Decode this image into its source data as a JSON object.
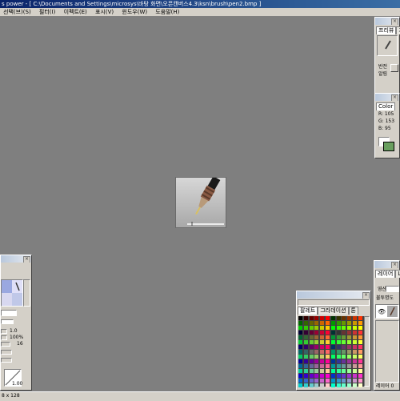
{
  "window": {
    "title": "s power - [ C:\\Documents and Settings\\microsys\\바탕 화면\\오픈캔버스4.3\\ksn\\brush\\pen2.bmp ]"
  },
  "menu": {
    "items": [
      "선택(브)(S)",
      "필터(I)",
      "이펙트(E)",
      "표시(V)",
      "윈도우(W)",
      "도움말(H)"
    ]
  },
  "brush_panel": {
    "tabs": [
      "프리뷰",
      "가"
    ],
    "side_label": "반전\n알림"
  },
  "color_panel": {
    "tab": "Color",
    "r_label": "R: 105",
    "g_label": "G: 153",
    "b_label": "B:  95",
    "fg_color": "#699f5f",
    "bg_color": "#ffffff"
  },
  "left_panel": {
    "value_1": "1.0",
    "value_2": "100%",
    "value_3": "16",
    "value_4": "1.00"
  },
  "palette_panel": {
    "tabs": [
      "팔레트",
      "그라데이션",
      "톤"
    ]
  },
  "layer_panel": {
    "tabs": [
      "레이어",
      "L"
    ],
    "mode_label": "영산",
    "opacity_label": "불투명도"
  },
  "status": {
    "size_text": "8 x 128",
    "layer_text": "레이어 0"
  },
  "palette_colors": [
    "#000000",
    "#330000",
    "#660000",
    "#990000",
    "#cc0000",
    "#ff0000",
    "#003300",
    "#333300",
    "#663300",
    "#993300",
    "#cc3300",
    "#ff3300",
    "#006600",
    "#336600",
    "#666600",
    "#996600",
    "#cc6600",
    "#ff6600",
    "#009900",
    "#339900",
    "#669900",
    "#999900",
    "#cc9900",
    "#ff9900",
    "#00cc00",
    "#33cc00",
    "#66cc00",
    "#99cc00",
    "#cccc00",
    "#ffcc00",
    "#00ff00",
    "#33ff00",
    "#66ff00",
    "#99ff00",
    "#ccff00",
    "#ffff00",
    "#000033",
    "#330033",
    "#660033",
    "#990033",
    "#cc0033",
    "#ff0033",
    "#003333",
    "#333333",
    "#663333",
    "#993333",
    "#cc3333",
    "#ff3333",
    "#006633",
    "#336633",
    "#666633",
    "#996633",
    "#cc6633",
    "#ff6633",
    "#009933",
    "#339933",
    "#669933",
    "#999933",
    "#cc9933",
    "#ff9933",
    "#00cc33",
    "#33cc33",
    "#66cc33",
    "#99cc33",
    "#cccc33",
    "#ffcc33",
    "#00ff33",
    "#33ff33",
    "#66ff33",
    "#99ff33",
    "#ccff33",
    "#ffff33",
    "#000066",
    "#330066",
    "#660066",
    "#990066",
    "#cc0066",
    "#ff0066",
    "#003366",
    "#333366",
    "#663366",
    "#993366",
    "#cc3366",
    "#ff3366",
    "#006666",
    "#336666",
    "#666666",
    "#996666",
    "#cc6666",
    "#ff6666",
    "#009966",
    "#339966",
    "#669966",
    "#999966",
    "#cc9966",
    "#ff9966",
    "#00cc66",
    "#33cc66",
    "#66cc66",
    "#99cc66",
    "#cccc66",
    "#ffcc66",
    "#00ff66",
    "#33ff66",
    "#66ff66",
    "#99ff66",
    "#ccff66",
    "#ffff66",
    "#000099",
    "#330099",
    "#660099",
    "#990099",
    "#cc0099",
    "#ff0099",
    "#003399",
    "#333399",
    "#663399",
    "#993399",
    "#cc3399",
    "#ff3399",
    "#006699",
    "#336699",
    "#666699",
    "#996699",
    "#cc6699",
    "#ff6699",
    "#009999",
    "#339999",
    "#669999",
    "#999999",
    "#cc9999",
    "#ff9999",
    "#00cc99",
    "#33cc99",
    "#66cc99",
    "#99cc99",
    "#cccc99",
    "#ffcc99",
    "#00ff99",
    "#33ff99",
    "#66ff99",
    "#99ff99",
    "#ccff99",
    "#ffff99",
    "#0000cc",
    "#3300cc",
    "#6600cc",
    "#9900cc",
    "#cc00cc",
    "#ff00cc",
    "#0033cc",
    "#3333cc",
    "#6633cc",
    "#9933cc",
    "#cc33cc",
    "#ff33cc",
    "#0066cc",
    "#3366cc",
    "#6666cc",
    "#9966cc",
    "#cc66cc",
    "#ff66cc",
    "#0099cc",
    "#3399cc",
    "#6699cc",
    "#9999cc",
    "#cc99cc",
    "#ff99cc",
    "#00cccc",
    "#33cccc",
    "#66cccc",
    "#99cccc",
    "#cccccc",
    "#ffcccc",
    "#00ffcc",
    "#33ffcc",
    "#66ffcc",
    "#99ffcc",
    "#ccffcc",
    "#ffffcc"
  ]
}
